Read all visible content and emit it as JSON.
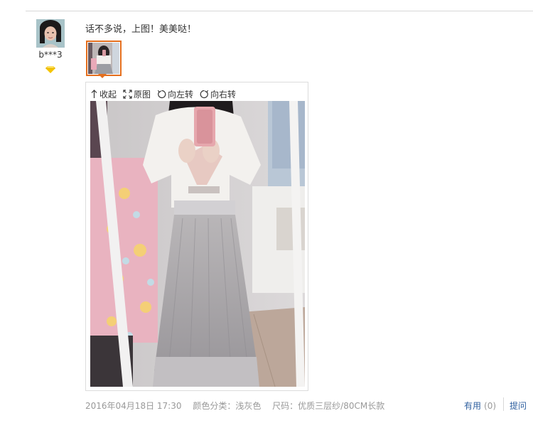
{
  "review": {
    "username": "b***3",
    "text": "话不多说，上图！美美哒！",
    "date": "2016年04月18日 17:30",
    "color_option": "颜色分类：浅灰色",
    "size_option": "尺码：优质三层纱/80CM长款"
  },
  "viewer_toolbar": {
    "collapse_label": "收起",
    "original_label": "原图",
    "rotate_left_label": "向左转",
    "rotate_right_label": "向右转"
  },
  "actions": {
    "useful_label": "有用",
    "useful_count": "(0)",
    "ask_label": "提问"
  },
  "colors": {
    "accent": "#e46f1e",
    "link": "#2e5f9f",
    "badge": "#f5c400"
  },
  "icons": [
    "up-arrow-icon",
    "expand-icon",
    "rotate-left-icon",
    "rotate-right-icon",
    "diamond-icon"
  ]
}
